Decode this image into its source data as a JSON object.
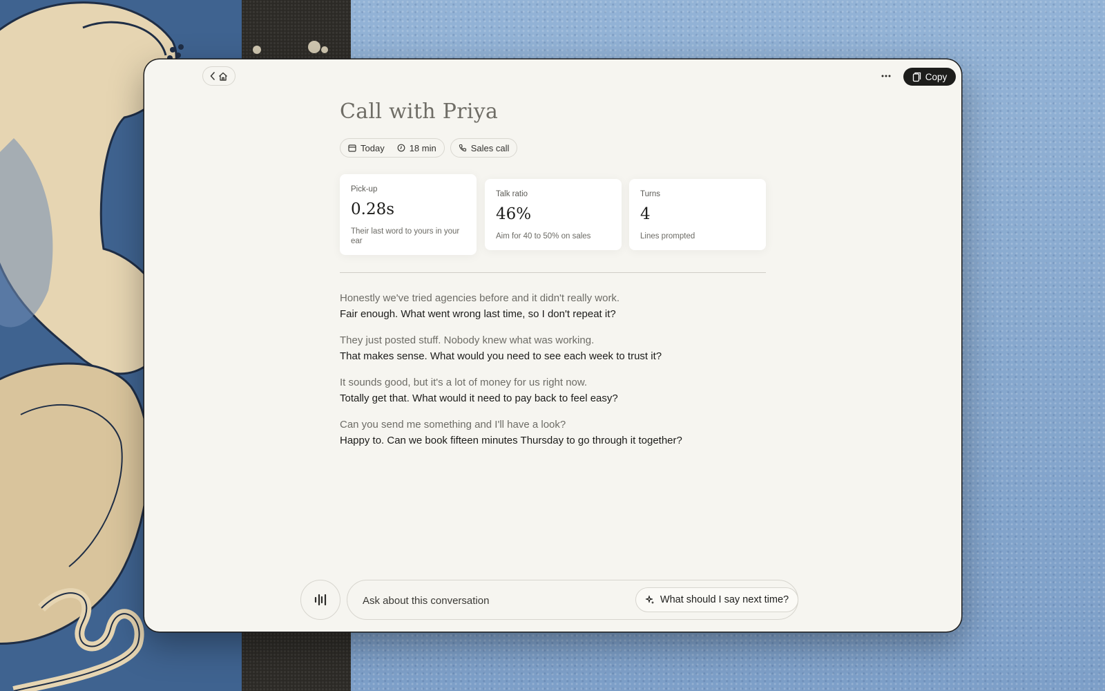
{
  "window": {
    "title": "Call with Priya",
    "copy_label": "Copy"
  },
  "meta": {
    "date": "Today",
    "duration": "18 min",
    "call_type": "Sales call"
  },
  "stats": [
    {
      "label": "Pick-up",
      "value": "0.28s",
      "note": "Their last word to yours in your ear"
    },
    {
      "label": "Talk ratio",
      "value": "46%",
      "note": "Aim for 40 to 50% on sales"
    },
    {
      "label": "Turns",
      "value": "4",
      "note": "Lines prompted"
    }
  ],
  "transcript": [
    {
      "them": "Honestly we've tried agencies before and it didn't really work.",
      "you": "Fair enough. What went wrong last time, so I don't repeat it?"
    },
    {
      "them": "They just posted stuff. Nobody knew what was working.",
      "you": "That makes sense. What would you need to see each week to trust it?"
    },
    {
      "them": "It sounds good, but it's a lot of money for us right now.",
      "you": "Totally get that. What would it need to pay back to feel easy?"
    },
    {
      "them": "Can you send me something and I'll have a look?",
      "you": "Happy to. Can we book fifteen minutes Thursday to go through it together?"
    }
  ],
  "composer": {
    "placeholder": "Ask about this conversation",
    "suggestion": "What should I say next time?"
  },
  "icons": {
    "back": "chevron-left-icon",
    "home": "home-icon",
    "more": "ellipsis-icon",
    "copy": "clipboard-icon",
    "date": "calendar-icon",
    "duration": "clock-icon",
    "call_type": "phone-icon",
    "mic": "waveform-icon",
    "suggest": "sparkle-icon"
  }
}
